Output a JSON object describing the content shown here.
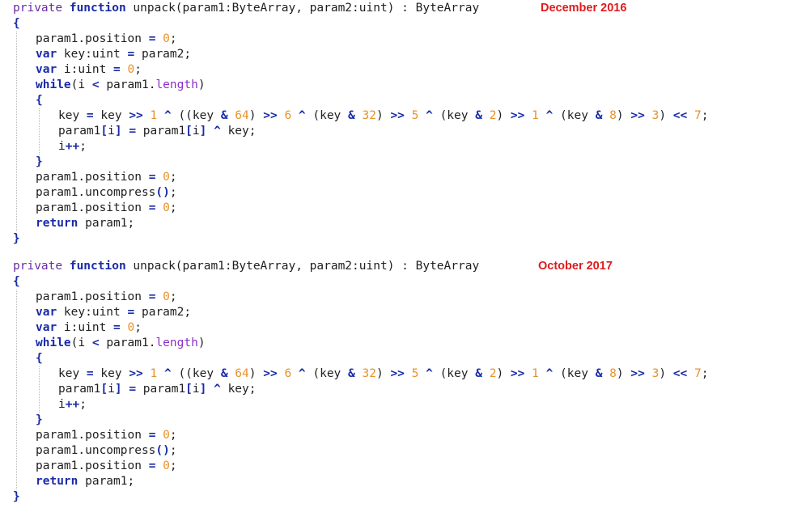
{
  "blocks": [
    {
      "date_label": "December 2016",
      "lines": [
        [
          [
            "kw-vis",
            "private"
          ],
          [
            "plain",
            " "
          ],
          [
            "kw",
            "function"
          ],
          [
            "plain",
            " unpack(param1:ByteArray, param2:uint) : ByteArray"
          ]
        ],
        [
          [
            "brace",
            "{"
          ]
        ],
        [
          [
            "plain",
            "param1.position "
          ],
          [
            "op",
            "="
          ],
          [
            "plain",
            " "
          ],
          [
            "num",
            "0"
          ],
          [
            "plain",
            ";"
          ]
        ],
        [
          [
            "kw",
            "var"
          ],
          [
            "plain",
            " key:uint "
          ],
          [
            "op",
            "="
          ],
          [
            "plain",
            " param2;"
          ]
        ],
        [
          [
            "kw",
            "var"
          ],
          [
            "plain",
            " i:uint "
          ],
          [
            "op",
            "="
          ],
          [
            "plain",
            " "
          ],
          [
            "num",
            "0"
          ],
          [
            "plain",
            ";"
          ]
        ],
        [
          [
            "kw",
            "while"
          ],
          [
            "plain",
            "(i "
          ],
          [
            "op",
            "<"
          ],
          [
            "plain",
            " param1."
          ],
          [
            "prop",
            "length"
          ],
          [
            "plain",
            ")"
          ]
        ],
        [
          [
            "brace",
            "{"
          ]
        ],
        [
          [
            "plain",
            "key "
          ],
          [
            "op",
            "="
          ],
          [
            "plain",
            " key "
          ],
          [
            "op",
            ">>"
          ],
          [
            "plain",
            " "
          ],
          [
            "num",
            "1"
          ],
          [
            "plain",
            " "
          ],
          [
            "op",
            "^"
          ],
          [
            "plain",
            " ((key "
          ],
          [
            "op",
            "&"
          ],
          [
            "plain",
            " "
          ],
          [
            "num",
            "64"
          ],
          [
            "plain",
            ") "
          ],
          [
            "op",
            ">>"
          ],
          [
            "plain",
            " "
          ],
          [
            "num",
            "6"
          ],
          [
            "plain",
            " "
          ],
          [
            "op",
            "^"
          ],
          [
            "plain",
            " (key "
          ],
          [
            "op",
            "&"
          ],
          [
            "plain",
            " "
          ],
          [
            "num",
            "32"
          ],
          [
            "plain",
            ") "
          ],
          [
            "op",
            ">>"
          ],
          [
            "plain",
            " "
          ],
          [
            "num",
            "5"
          ],
          [
            "plain",
            " "
          ],
          [
            "op",
            "^"
          ],
          [
            "plain",
            " (key "
          ],
          [
            "op",
            "&"
          ],
          [
            "plain",
            " "
          ],
          [
            "num",
            "2"
          ],
          [
            "plain",
            ") "
          ],
          [
            "op",
            ">>"
          ],
          [
            "plain",
            " "
          ],
          [
            "num",
            "1"
          ],
          [
            "plain",
            " "
          ],
          [
            "op",
            "^"
          ],
          [
            "plain",
            " (key "
          ],
          [
            "op",
            "&"
          ],
          [
            "plain",
            " "
          ],
          [
            "num",
            "8"
          ],
          [
            "plain",
            ") "
          ],
          [
            "op",
            ">>"
          ],
          [
            "plain",
            " "
          ],
          [
            "num",
            "3"
          ],
          [
            "plain",
            ") "
          ],
          [
            "op",
            "<<"
          ],
          [
            "plain",
            " "
          ],
          [
            "num",
            "7"
          ],
          [
            "plain",
            ";"
          ]
        ],
        [
          [
            "plain",
            "param1"
          ],
          [
            "op",
            "["
          ],
          [
            "plain",
            "i"
          ],
          [
            "op",
            "]"
          ],
          [
            "plain",
            " "
          ],
          [
            "op",
            "="
          ],
          [
            "plain",
            " param1"
          ],
          [
            "op",
            "["
          ],
          [
            "plain",
            "i"
          ],
          [
            "op",
            "]"
          ],
          [
            "plain",
            " "
          ],
          [
            "op",
            "^"
          ],
          [
            "plain",
            " key;"
          ]
        ],
        [
          [
            "plain",
            "i"
          ],
          [
            "op",
            "++"
          ],
          [
            "plain",
            ";"
          ]
        ],
        [
          [
            "brace",
            "}"
          ]
        ],
        [
          [
            "plain",
            "param1.position "
          ],
          [
            "op",
            "="
          ],
          [
            "plain",
            " "
          ],
          [
            "num",
            "0"
          ],
          [
            "plain",
            ";"
          ]
        ],
        [
          [
            "plain",
            "param1.uncompress"
          ],
          [
            "op",
            "()"
          ],
          [
            "plain",
            ";"
          ]
        ],
        [
          [
            "plain",
            "param1.position "
          ],
          [
            "op",
            "="
          ],
          [
            "plain",
            " "
          ],
          [
            "num",
            "0"
          ],
          [
            "plain",
            ";"
          ]
        ],
        [
          [
            "kw",
            "return"
          ],
          [
            "plain",
            " param1;"
          ]
        ],
        [
          [
            "brace",
            "}"
          ]
        ]
      ]
    },
    {
      "date_label": "October 2017",
      "lines": [
        [
          [
            "kw-vis",
            "private"
          ],
          [
            "plain",
            " "
          ],
          [
            "kw",
            "function"
          ],
          [
            "plain",
            " unpack(param1:ByteArray, param2:uint) : ByteArray"
          ]
        ],
        [
          [
            "brace",
            "{"
          ]
        ],
        [
          [
            "plain",
            "param1.position "
          ],
          [
            "op",
            "="
          ],
          [
            "plain",
            " "
          ],
          [
            "num",
            "0"
          ],
          [
            "plain",
            ";"
          ]
        ],
        [
          [
            "kw",
            "var"
          ],
          [
            "plain",
            " key:uint "
          ],
          [
            "op",
            "="
          ],
          [
            "plain",
            " param2;"
          ]
        ],
        [
          [
            "kw",
            "var"
          ],
          [
            "plain",
            " i:uint "
          ],
          [
            "op",
            "="
          ],
          [
            "plain",
            " "
          ],
          [
            "num",
            "0"
          ],
          [
            "plain",
            ";"
          ]
        ],
        [
          [
            "kw",
            "while"
          ],
          [
            "plain",
            "(i "
          ],
          [
            "op",
            "<"
          ],
          [
            "plain",
            " param1."
          ],
          [
            "prop",
            "length"
          ],
          [
            "plain",
            ")"
          ]
        ],
        [
          [
            "brace",
            "{"
          ]
        ],
        [
          [
            "plain",
            "key "
          ],
          [
            "op",
            "="
          ],
          [
            "plain",
            " key "
          ],
          [
            "op",
            ">>"
          ],
          [
            "plain",
            " "
          ],
          [
            "num",
            "1"
          ],
          [
            "plain",
            " "
          ],
          [
            "op",
            "^"
          ],
          [
            "plain",
            " ((key "
          ],
          [
            "op",
            "&"
          ],
          [
            "plain",
            " "
          ],
          [
            "num",
            "64"
          ],
          [
            "plain",
            ") "
          ],
          [
            "op",
            ">>"
          ],
          [
            "plain",
            " "
          ],
          [
            "num",
            "6"
          ],
          [
            "plain",
            " "
          ],
          [
            "op",
            "^"
          ],
          [
            "plain",
            " (key "
          ],
          [
            "op",
            "&"
          ],
          [
            "plain",
            " "
          ],
          [
            "num",
            "32"
          ],
          [
            "plain",
            ") "
          ],
          [
            "op",
            ">>"
          ],
          [
            "plain",
            " "
          ],
          [
            "num",
            "5"
          ],
          [
            "plain",
            " "
          ],
          [
            "op",
            "^"
          ],
          [
            "plain",
            " (key "
          ],
          [
            "op",
            "&"
          ],
          [
            "plain",
            " "
          ],
          [
            "num",
            "2"
          ],
          [
            "plain",
            ") "
          ],
          [
            "op",
            ">>"
          ],
          [
            "plain",
            " "
          ],
          [
            "num",
            "1"
          ],
          [
            "plain",
            " "
          ],
          [
            "op",
            "^"
          ],
          [
            "plain",
            " (key "
          ],
          [
            "op",
            "&"
          ],
          [
            "plain",
            " "
          ],
          [
            "num",
            "8"
          ],
          [
            "plain",
            ") "
          ],
          [
            "op",
            ">>"
          ],
          [
            "plain",
            " "
          ],
          [
            "num",
            "3"
          ],
          [
            "plain",
            ") "
          ],
          [
            "op",
            "<<"
          ],
          [
            "plain",
            " "
          ],
          [
            "num",
            "7"
          ],
          [
            "plain",
            ";"
          ]
        ],
        [
          [
            "plain",
            "param1"
          ],
          [
            "op",
            "["
          ],
          [
            "plain",
            "i"
          ],
          [
            "op",
            "]"
          ],
          [
            "plain",
            " "
          ],
          [
            "op",
            "="
          ],
          [
            "plain",
            " param1"
          ],
          [
            "op",
            "["
          ],
          [
            "plain",
            "i"
          ],
          [
            "op",
            "]"
          ],
          [
            "plain",
            " "
          ],
          [
            "op",
            "^"
          ],
          [
            "plain",
            " key;"
          ]
        ],
        [
          [
            "plain",
            "i"
          ],
          [
            "op",
            "++"
          ],
          [
            "plain",
            ";"
          ]
        ],
        [
          [
            "brace",
            "}"
          ]
        ],
        [
          [
            "plain",
            "param1.position "
          ],
          [
            "op",
            "="
          ],
          [
            "plain",
            " "
          ],
          [
            "num",
            "0"
          ],
          [
            "plain",
            ";"
          ]
        ],
        [
          [
            "plain",
            "param1.uncompress"
          ],
          [
            "op",
            "()"
          ],
          [
            "plain",
            ";"
          ]
        ],
        [
          [
            "plain",
            "param1.position "
          ],
          [
            "op",
            "="
          ],
          [
            "plain",
            " "
          ],
          [
            "num",
            "0"
          ],
          [
            "plain",
            ";"
          ]
        ],
        [
          [
            "kw",
            "return"
          ],
          [
            "plain",
            " param1;"
          ]
        ],
        [
          [
            "brace",
            "}"
          ]
        ]
      ]
    }
  ],
  "colors": {
    "keyword": "#1a2ba8",
    "visibility": "#6b2aa8",
    "number": "#e8922a",
    "property": "#8a2fc9",
    "date_label": "#e2191c",
    "guide": "#b9b9b9"
  }
}
